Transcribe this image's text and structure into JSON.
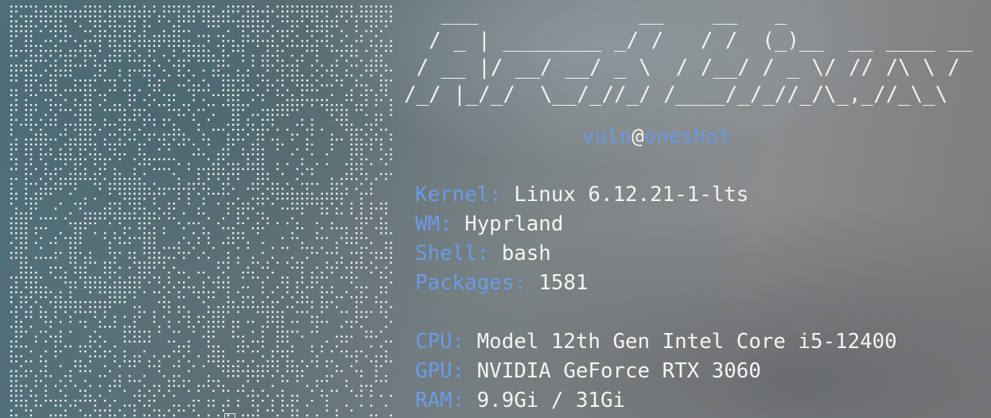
{
  "window": {
    "type": "terminal",
    "accent_color": "#6c9be8",
    "text_color": "#f4f4f4"
  },
  "ascii_logo": {
    "lines": [
      "   ___             __    __   _",
      "  / _ | ________ _/ /   / /  (_)__  __ ____ __",
      " / __ |/ __/ __/ _ \\  / /__/ / _ \\/ // /\\ \\ /",
      "/_/ |_/_/  \\__/_//_/ /____/_/_//_/\\_,_//_\\_\\"
    ]
  },
  "user_host": {
    "user": "vuln",
    "separator": "@",
    "host": "oneshot"
  },
  "system_info": [
    {
      "key": "Kernel:",
      "value": "Linux 6.12.21-1-lts"
    },
    {
      "key": "WM:",
      "value": "Hyprland"
    },
    {
      "key": "Shell:",
      "value": "bash"
    },
    {
      "key": "Packages:",
      "value": "1581"
    }
  ],
  "hardware_info": [
    {
      "key": "CPU:",
      "value": "Model 12th Gen Intel Core i5-12400"
    },
    {
      "key": "GPU:",
      "value": "NVIDIA GeForce RTX 3060"
    },
    {
      "key": "RAM:",
      "value": "9.9Gi / 31Gi"
    }
  ]
}
